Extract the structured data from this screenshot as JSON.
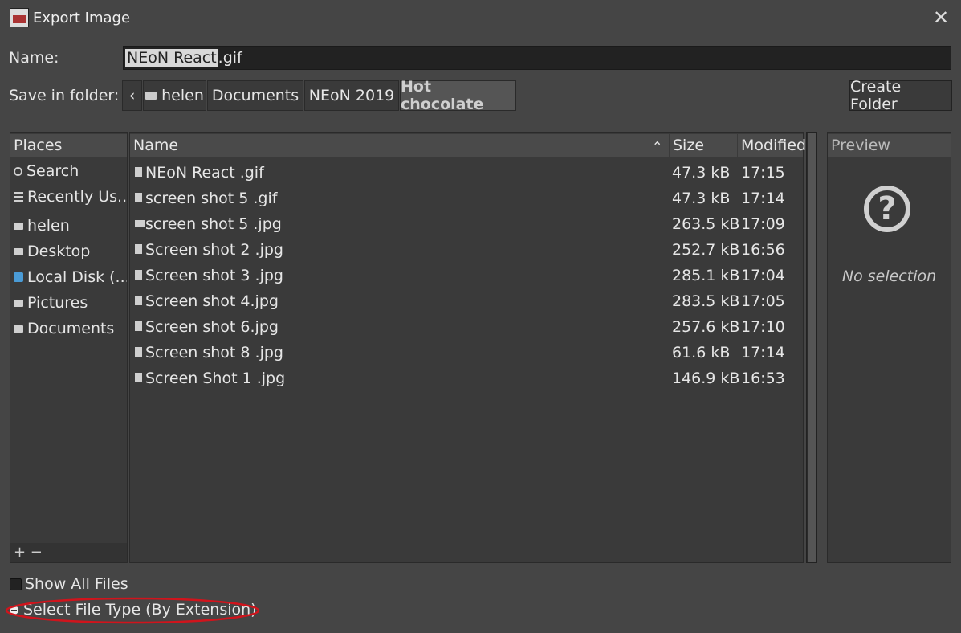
{
  "window": {
    "title": "Export Image",
    "close_glyph": "✕"
  },
  "name_row": {
    "label": "Name:",
    "value_selected": "NEoN React ",
    "value_rest": ".gif"
  },
  "folder_row": {
    "label": "Save in folder:",
    "back_glyph": "‹",
    "crumbs": [
      "helen",
      "Documents",
      "NEoN 2019",
      "Hot chocolate"
    ],
    "create_folder": "Create Folder"
  },
  "places": {
    "header": "Places",
    "items": [
      {
        "label": "Search",
        "icon": "search-icon"
      },
      {
        "label": "Recently Us...",
        "icon": "recent-icon"
      },
      {
        "label": "helen",
        "icon": "folder-icon"
      },
      {
        "label": "Desktop",
        "icon": "folder-icon"
      },
      {
        "label": "Local Disk (...",
        "icon": "disk-icon"
      },
      {
        "label": "Pictures",
        "icon": "folder-icon"
      },
      {
        "label": "Documents",
        "icon": "folder-icon"
      }
    ],
    "footer": "+ −"
  },
  "files": {
    "columns": {
      "name": "Name",
      "sort_glyph": "⌃",
      "size": "Size",
      "modified": "Modified"
    },
    "rows": [
      {
        "name": "NEoN React .gif",
        "size": "47.3 kB",
        "modified": "17:15",
        "icon": "gif"
      },
      {
        "name": "screen shot 5 .gif",
        "size": "47.3 kB",
        "modified": "17:14",
        "icon": "gif"
      },
      {
        "name": "screen shot 5 .jpg",
        "size": "263.5 kB",
        "modified": "17:09",
        "icon": "jpg"
      },
      {
        "name": "Screen shot 2 .jpg",
        "size": "252.7 kB",
        "modified": "16:56",
        "icon": "gif"
      },
      {
        "name": "Screen shot 3 .jpg",
        "size": "285.1 kB",
        "modified": "17:04",
        "icon": "gif"
      },
      {
        "name": "Screen shot 4.jpg",
        "size": "283.5 kB",
        "modified": "17:05",
        "icon": "gif"
      },
      {
        "name": "Screen shot 6.jpg",
        "size": "257.6 kB",
        "modified": "17:10",
        "icon": "gif"
      },
      {
        "name": "Screen shot 8 .jpg",
        "size": "61.6 kB",
        "modified": "17:14",
        "icon": "gif"
      },
      {
        "name": "Screen Shot 1 .jpg",
        "size": "146.9 kB",
        "modified": "16:53",
        "icon": "gif"
      }
    ]
  },
  "preview": {
    "header": "Preview",
    "glyph": "?",
    "empty": "No selection"
  },
  "options": {
    "show_all_files": "Show All Files",
    "select_file_type": "Select File Type (By Extension)"
  },
  "colors": {
    "background": "#454545",
    "pane": "#3a3a3a",
    "highlight_ellipse": "#d0141c"
  }
}
